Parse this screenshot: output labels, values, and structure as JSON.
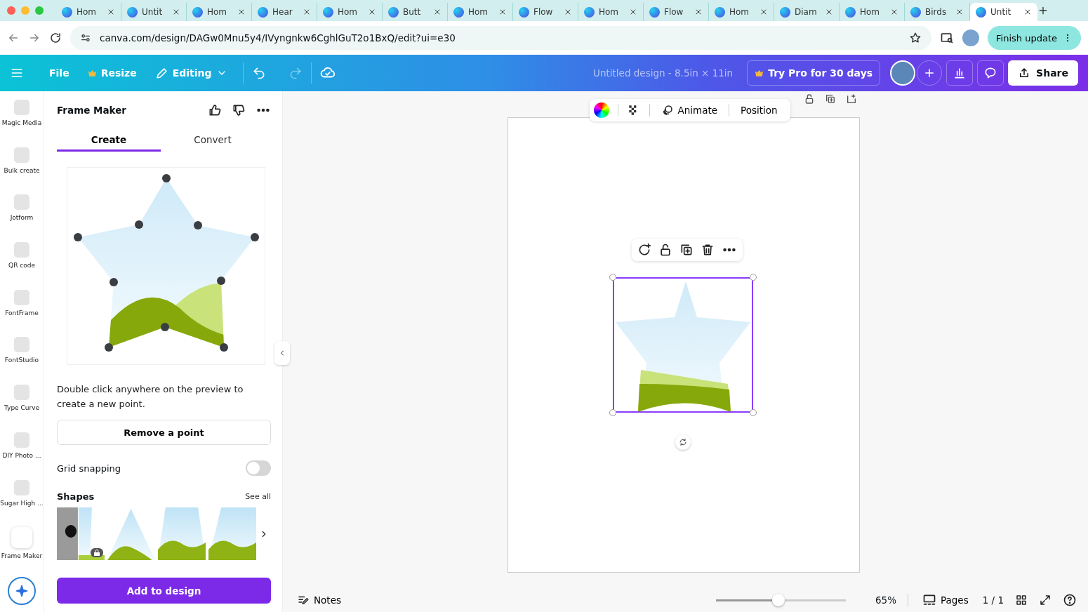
{
  "browser": {
    "tabs": [
      {
        "title": "Hom",
        "selected": false
      },
      {
        "title": "Untit",
        "selected": false
      },
      {
        "title": "Hom",
        "selected": false
      },
      {
        "title": "Hear",
        "selected": false
      },
      {
        "title": "Hom",
        "selected": false
      },
      {
        "title": "Butt",
        "selected": false
      },
      {
        "title": "Hom",
        "selected": false
      },
      {
        "title": "Flow",
        "selected": false
      },
      {
        "title": "Hom",
        "selected": false
      },
      {
        "title": "Flow",
        "selected": false
      },
      {
        "title": "Hom",
        "selected": false
      },
      {
        "title": "Diam",
        "selected": false
      },
      {
        "title": "Hom",
        "selected": false
      },
      {
        "title": "Birds",
        "selected": false
      },
      {
        "title": "Untit",
        "selected": true
      }
    ],
    "url": "canva.com/design/DAGw0Mnu5y4/IVyngnkw6CghlGuT2o1BxQ/edit?ui=e30",
    "finish_update": "Finish update"
  },
  "header": {
    "menu": [
      {
        "label": "File",
        "kind": "plain"
      },
      {
        "label": "Resize",
        "kind": "crown"
      },
      {
        "label": "Editing",
        "kind": "dropdown"
      }
    ],
    "undo": {
      "disabled": false
    },
    "redo": {
      "disabled": true
    },
    "title": "Untitled design - 8.5in × 11in",
    "pro": "Try Pro for 30 days",
    "share": "Share"
  },
  "rail": {
    "apps": [
      {
        "label": "Magic Media",
        "selected": false
      },
      {
        "label": "Bulk create",
        "selected": false
      },
      {
        "label": "Jotform",
        "selected": false
      },
      {
        "label": "QR code",
        "selected": false
      },
      {
        "label": "FontFrame",
        "selected": false
      },
      {
        "label": "FontStudio",
        "selected": false
      },
      {
        "label": "Type Curve",
        "selected": false
      },
      {
        "label": "DIY Photo ...",
        "selected": false
      },
      {
        "label": "Sugar High ...",
        "selected": false
      },
      {
        "label": "Frame Maker",
        "selected": true
      }
    ]
  },
  "panel": {
    "title": "Frame Maker",
    "tabs": [
      {
        "label": "Create",
        "selected": true
      },
      {
        "label": "Convert",
        "selected": false
      }
    ],
    "hint": "Double click anywhere on the preview to create a new point.",
    "remove_button": "Remove a point",
    "grid_snapping": {
      "label": "Grid snapping",
      "on": false
    },
    "shapes": {
      "title": "Shapes",
      "see_all": "See all",
      "items": [
        {
          "kind": "photo-split",
          "locked": true
        },
        {
          "kind": "peak",
          "locked": false
        },
        {
          "kind": "trapezoid",
          "locked": false
        },
        {
          "kind": "slant",
          "locked": false
        }
      ]
    },
    "add_button": "Add to design"
  },
  "canvas": {
    "toolbar": [
      {
        "label": "Animate"
      },
      {
        "label": "Position"
      }
    ]
  },
  "bottom": {
    "notes": "Notes",
    "zoom": {
      "level": 0.48,
      "reading": "65%"
    },
    "pages": "Pages",
    "page_count": "1 / 1"
  }
}
